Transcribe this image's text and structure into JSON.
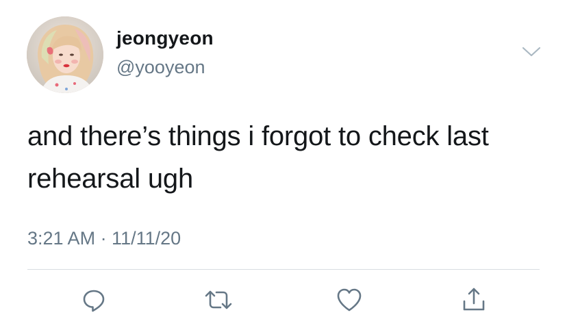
{
  "tweet": {
    "display_name": "jeongyeon",
    "handle": "@yooyeon",
    "text_line1": "and there’s things i forgot to check last",
    "text_line2": "rehearsal ugh",
    "timestamp": "3:21 AM · 11/11/20"
  },
  "icons": {
    "menu": "chevron-down-icon",
    "reply": "reply-icon",
    "retweet": "retweet-icon",
    "like": "heart-icon",
    "share": "share-icon"
  },
  "colors": {
    "text": "#14171a",
    "secondary": "#657786",
    "divider": "#d8dde1"
  }
}
